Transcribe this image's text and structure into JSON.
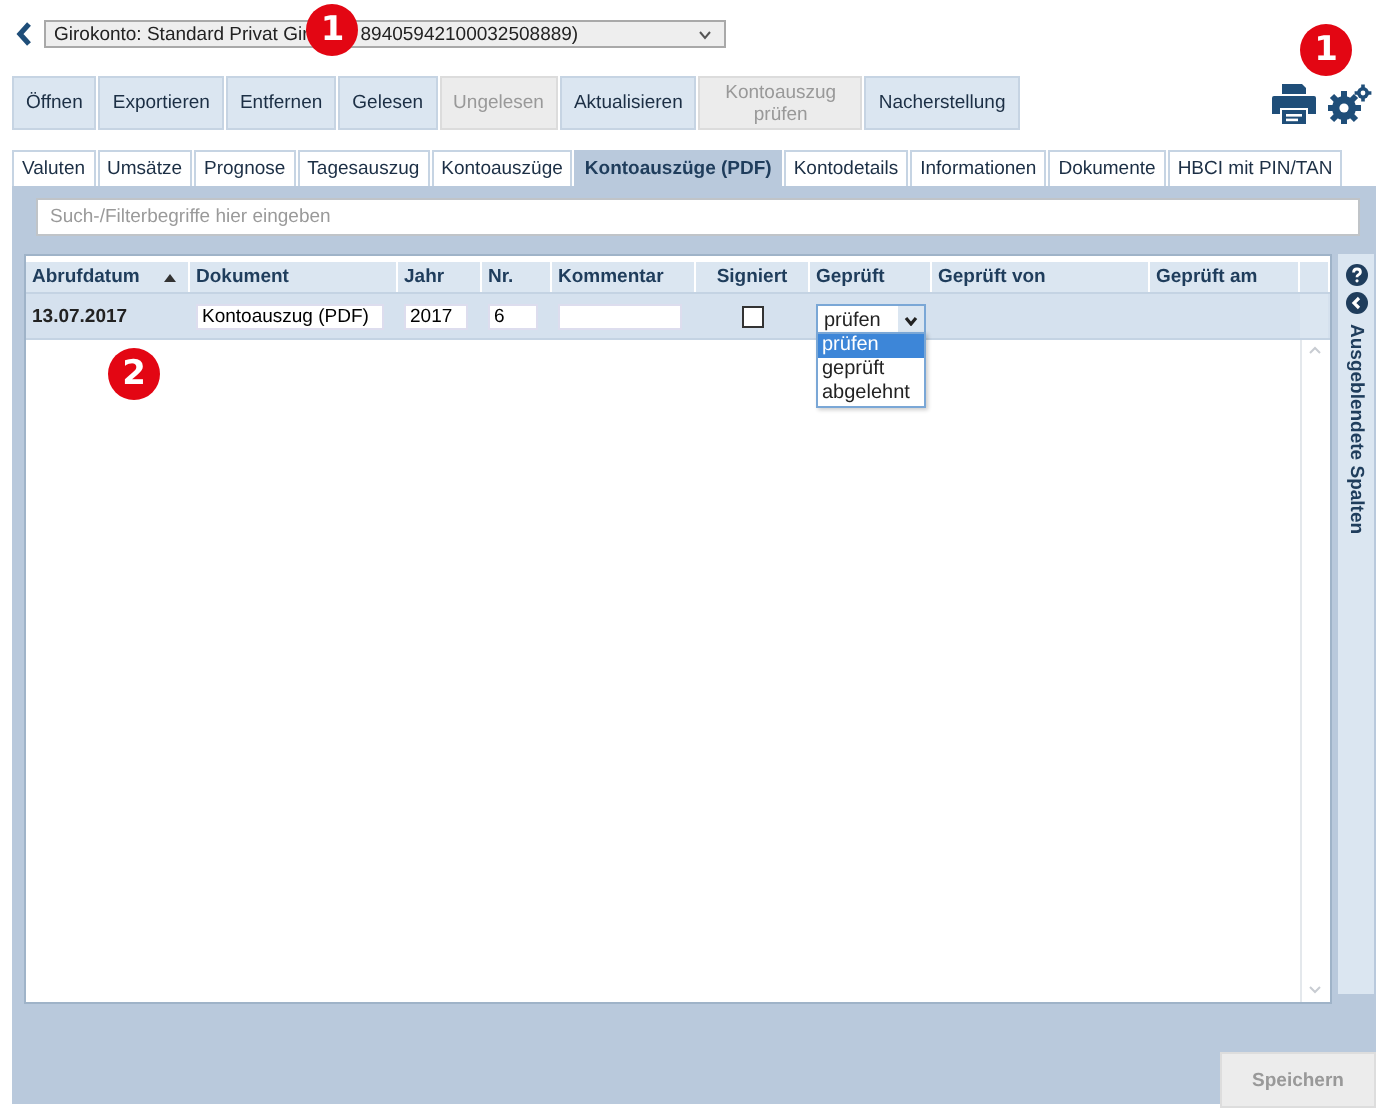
{
  "account_select": {
    "text_before": "Girokonto: Standard Privat Gir",
    "text_after": "89405942100032508889)"
  },
  "toolbar": [
    {
      "label": "Öffnen",
      "disabled": false
    },
    {
      "label": "Exportieren",
      "disabled": false
    },
    {
      "label": "Entfernen",
      "disabled": false
    },
    {
      "label": "Gelesen",
      "disabled": false
    },
    {
      "label": "Ungelesen",
      "disabled": true
    },
    {
      "label": "Aktualisieren",
      "disabled": false
    },
    {
      "label": "Kontoauszug prüfen",
      "disabled": true
    },
    {
      "label": "Nacherstellung",
      "disabled": false
    }
  ],
  "tabs": [
    {
      "label": "Valuten",
      "selected": false
    },
    {
      "label": "Umsätze",
      "selected": false
    },
    {
      "label": "Prognose",
      "selected": false
    },
    {
      "label": "Tagesauszug",
      "selected": false
    },
    {
      "label": "Kontoauszüge",
      "selected": false
    },
    {
      "label": "Kontoauszüge (PDF)",
      "selected": true
    },
    {
      "label": "Kontodetails",
      "selected": false
    },
    {
      "label": "Informationen",
      "selected": false
    },
    {
      "label": "Dokumente",
      "selected": false
    },
    {
      "label": "HBCI mit PIN/TAN",
      "selected": false
    }
  ],
  "search": {
    "placeholder": "Such-/Filterbegriffe hier eingeben"
  },
  "table": {
    "columns": [
      {
        "label": "Abrufdatum",
        "sorted": true
      },
      {
        "label": "Dokument",
        "sorted": false
      },
      {
        "label": "Jahr",
        "sorted": false
      },
      {
        "label": "Nr.",
        "sorted": false
      },
      {
        "label": "Kommentar",
        "sorted": false
      },
      {
        "label": "Signiert",
        "sorted": false
      },
      {
        "label": "Geprüft",
        "sorted": false
      },
      {
        "label": "Geprüft von",
        "sorted": false
      },
      {
        "label": "Geprüft am",
        "sorted": false
      }
    ],
    "rows": [
      {
        "cells": [
          {
            "kind": "text",
            "value": "13.07.2017"
          },
          {
            "kind": "input",
            "value": "Kontoauszug (PDF)"
          },
          {
            "kind": "input",
            "value": "2017"
          },
          {
            "kind": "input",
            "value": "6"
          },
          {
            "kind": "input"
          },
          {
            "kind": "checkbox",
            "checked": false
          },
          {
            "kind": "select",
            "value": "prüfen",
            "expanded": true,
            "options": [
              {
                "label": "prüfen",
                "selected": true
              },
              {
                "label": "geprüft",
                "selected": false
              },
              {
                "label": "abgelehnt",
                "selected": false
              }
            ]
          },
          {
            "kind": "empty"
          },
          {
            "kind": "empty"
          }
        ]
      }
    ]
  },
  "side_panel": {
    "label": "Ausgeblendete Spalten"
  },
  "save_button": {
    "label": "Speichern",
    "disabled": true
  },
  "callouts": [
    {
      "label": "1"
    },
    {
      "label": "1"
    },
    {
      "label": "2"
    }
  ]
}
